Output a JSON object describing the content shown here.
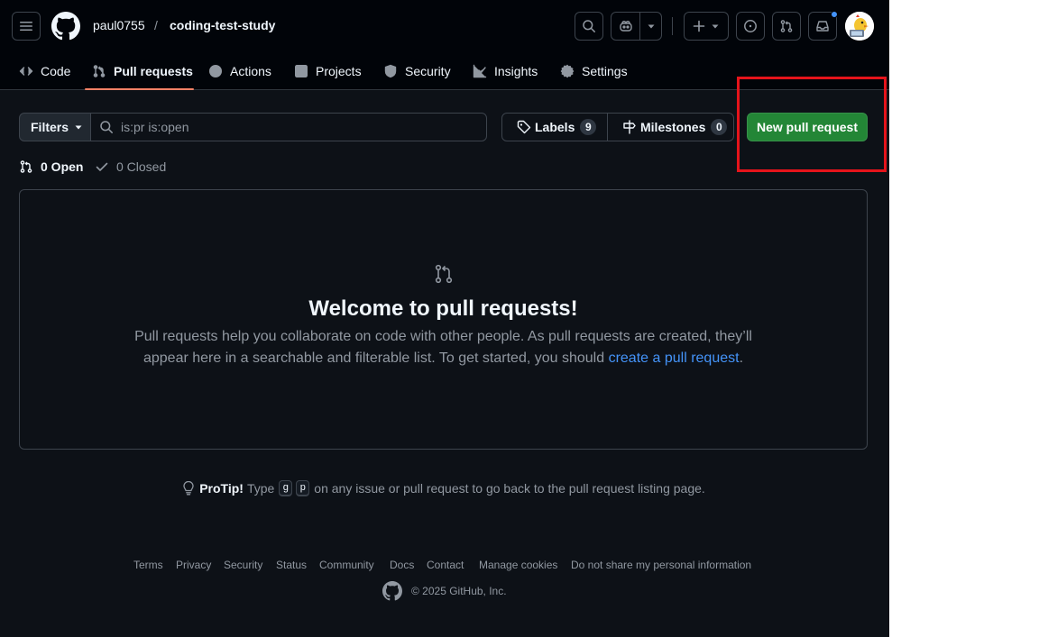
{
  "repo": {
    "owner": "paul0755",
    "separator": "/",
    "name": "coding-test-study"
  },
  "tabs": [
    {
      "label": "Code",
      "icon": "code-icon"
    },
    {
      "label": "Pull requests",
      "icon": "git-pull-request-icon",
      "active": true
    },
    {
      "label": "Actions",
      "icon": "play-icon"
    },
    {
      "label": "Projects",
      "icon": "table-icon"
    },
    {
      "label": "Security",
      "icon": "shield-icon"
    },
    {
      "label": "Insights",
      "icon": "graph-icon"
    },
    {
      "label": "Settings",
      "icon": "gear-icon"
    }
  ],
  "toolbar": {
    "filters_label": "Filters",
    "search_value": "is:pr is:open",
    "labels_label": "Labels",
    "labels_count": "9",
    "milestones_label": "Milestones",
    "milestones_count": "0",
    "new_pr_label": "New pull request"
  },
  "states": {
    "open_label": "0 Open",
    "closed_label": "0 Closed"
  },
  "blankslate": {
    "title": "Welcome to pull requests!",
    "line1": "Pull requests help you collaborate on code with other people. As pull requests are created, they’ll",
    "line2_prefix": "appear here in a searchable and filterable list. To get started, you should ",
    "link": "create a pull request",
    "line2_suffix": "."
  },
  "protip": {
    "label": "ProTip!",
    "text_before": "Type",
    "key1": "g",
    "key2": "p",
    "text_after": "on any issue or pull request to go back to the pull request listing page."
  },
  "footer": {
    "links": [
      "Terms",
      "Privacy",
      "Security",
      "Status",
      "Community",
      "Docs",
      "Contact",
      "Manage cookies",
      "Do not share my personal information"
    ],
    "copyright": "© 2025 GitHub, Inc."
  },
  "colors": {
    "background": "#0d1117",
    "header": "#010409",
    "accent_link": "#4493f8",
    "primary_button": "#238636",
    "tab_underline": "#f78166",
    "highlight_box": "#e5141b",
    "notification_dot": "#4493f8"
  }
}
